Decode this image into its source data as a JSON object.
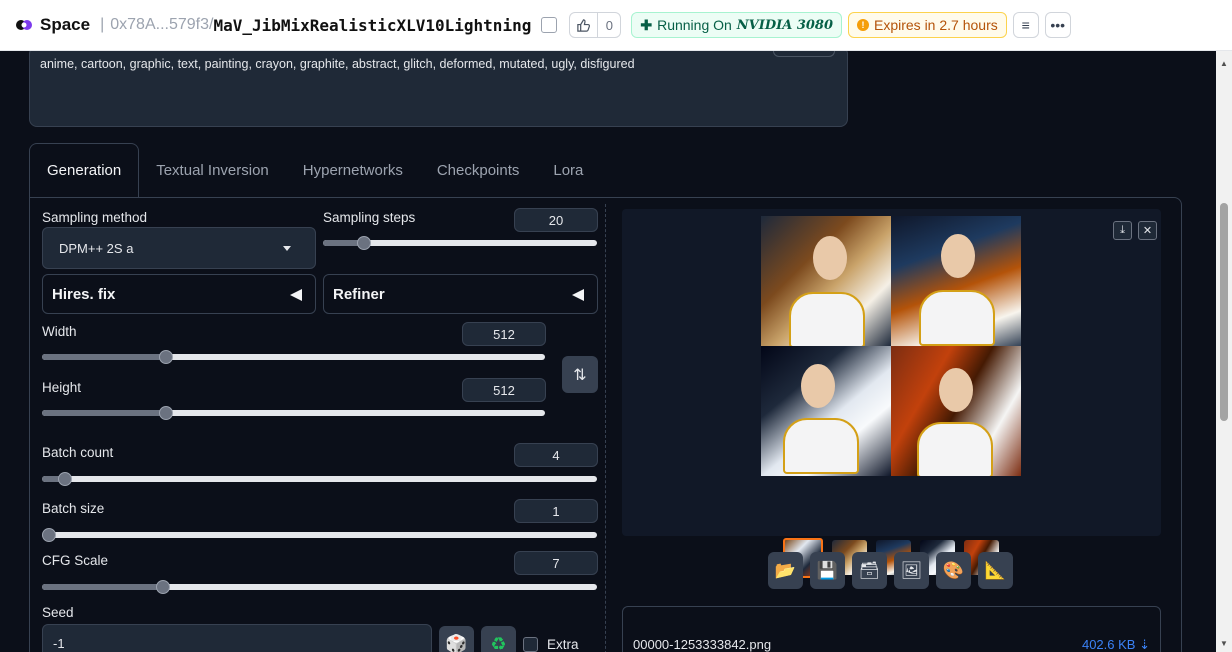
{
  "topbar": {
    "logo_text": "Space",
    "separator": "|",
    "owner": "0x78A...579f3",
    "slash": "/",
    "repo": "MaV_JibMixRealisticXLV10Lightning",
    "like_count": "0",
    "running_label": "Running On",
    "hardware": "NVIDIA 3080",
    "expires": "Expires in 2.7 hours"
  },
  "negative_prompt": "anime, cartoon, graphic, text, painting, crayon, graphite, abstract, glitch, deformed, mutated, ugly, disfigured",
  "tabs": [
    "Generation",
    "Textual Inversion",
    "Hypernetworks",
    "Checkpoints",
    "Lora"
  ],
  "settings": {
    "sampling_method_label": "Sampling method",
    "sampling_method_value": "DPM++ 2S a",
    "sampling_steps_label": "Sampling steps",
    "sampling_steps_value": "20",
    "sampling_steps_fraction": 0.13,
    "hires_label": "Hires. fix",
    "refiner_label": "Refiner",
    "width_label": "Width",
    "width_value": "512",
    "width_fraction": 0.24,
    "height_label": "Height",
    "height_value": "512",
    "height_fraction": 0.24,
    "batch_count_label": "Batch count",
    "batch_count_value": "4",
    "batch_count_fraction": 0.03,
    "batch_size_label": "Batch size",
    "batch_size_value": "1",
    "batch_size_fraction": 0.0,
    "cfg_label": "CFG Scale",
    "cfg_value": "7",
    "cfg_fraction": 0.21,
    "seed_label": "Seed",
    "seed_value": "-1",
    "extra_label": "Extra"
  },
  "output": {
    "filename": "00000-1253333842.png",
    "filesize": "402.6 KB"
  },
  "colors": {
    "accent": "#f97316",
    "link": "#3b82f6",
    "bg": "#0b0f19"
  }
}
